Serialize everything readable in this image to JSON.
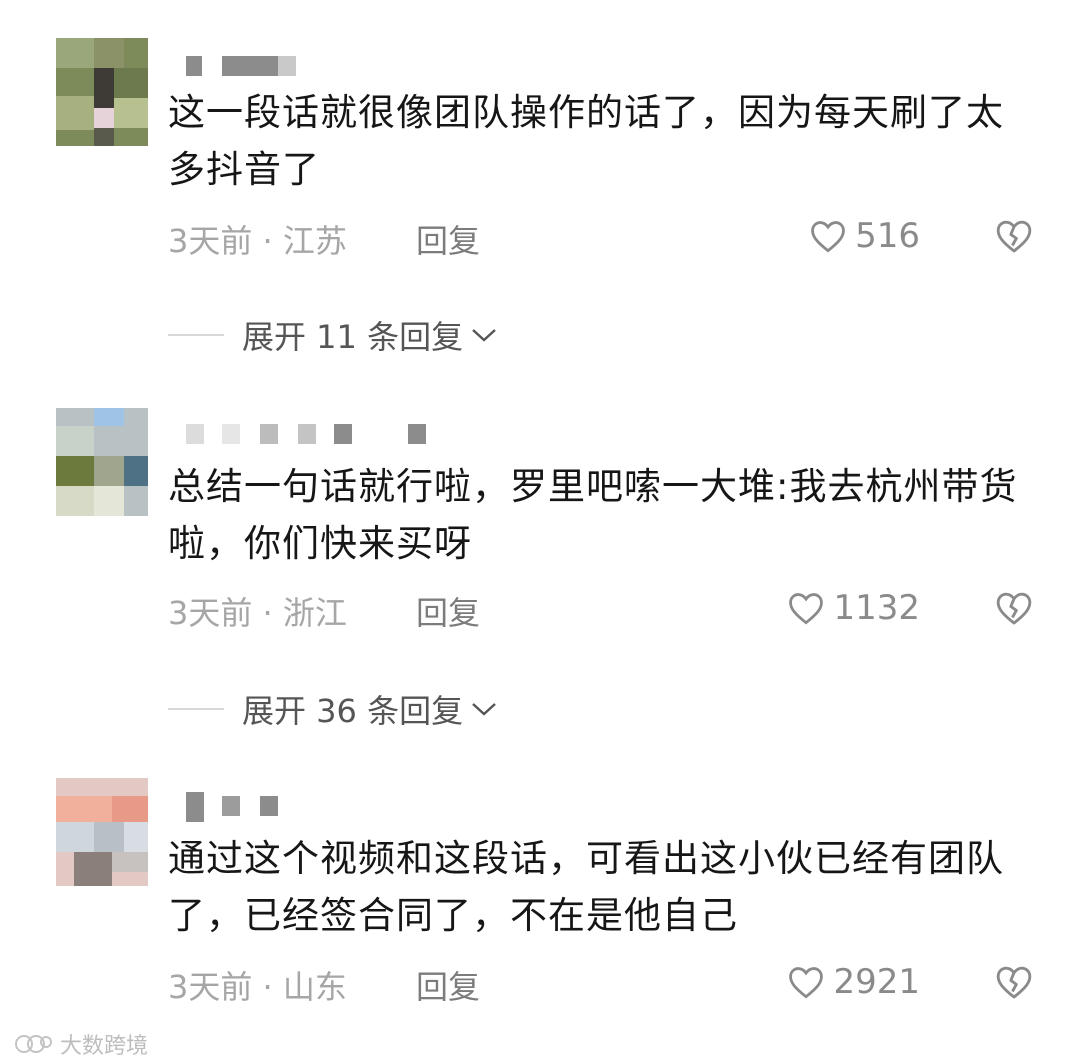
{
  "comments": [
    {
      "text": "这一段话就很像团队操作的话了，因为每天刷了太多抖音了",
      "meta": "3天前 · 江苏",
      "reply_label": "回复",
      "likes": "516",
      "expand_label": "展开 11 条回复"
    },
    {
      "text": "总结一句话就行啦，罗里吧嗦一大堆:我去杭州带货啦，你们快来买呀",
      "meta": "3天前 · 浙江",
      "reply_label": "回复",
      "likes": "1132",
      "expand_label": "展开 36 条回复"
    },
    {
      "text": "通过这个视频和这段话，可看出这小伙已经有团队了，已经签合同了，不在是他自己",
      "meta": "3天前 · 山东",
      "reply_label": "回复",
      "likes": "2921"
    }
  ],
  "icons": {
    "like": "heart-outline-icon",
    "dislike": "broken-heart-icon",
    "expand": "chevron-down-icon"
  },
  "watermark": "大数跨境",
  "colors": {
    "text": "#161616",
    "meta": "#a6a6a6",
    "icon": "#8a8a8a"
  }
}
